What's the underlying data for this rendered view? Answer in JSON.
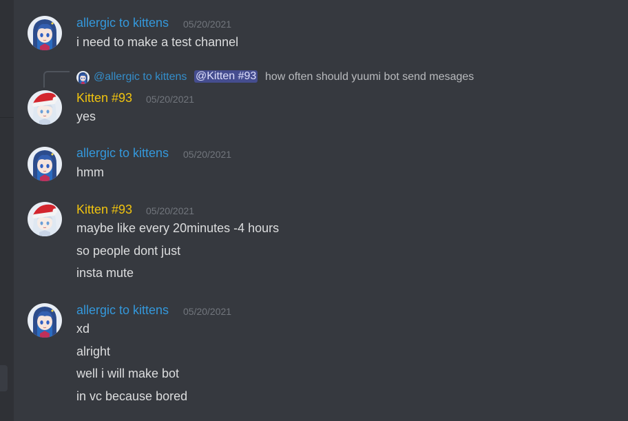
{
  "users": {
    "allergic": {
      "name": "allergic to kittens",
      "color": "#3498db",
      "avatar_icon": "anime-girl-blue-hair-avatar-icon"
    },
    "kitten": {
      "name": "Kitten #93",
      "color": "#f1c40f",
      "avatar_icon": "anime-girl-santa-hat-avatar-icon"
    }
  },
  "messages": [
    {
      "author": "allergic to kittens",
      "timestamp": "05/20/2021",
      "lines": [
        "i need to make a test channel"
      ]
    },
    {
      "reply": {
        "author": "@allergic to kittens",
        "mention": "@Kitten #93",
        "text": "how often should yuumi bot send mesages"
      },
      "author": "Kitten #93",
      "timestamp": "05/20/2021",
      "lines": [
        "yes"
      ]
    },
    {
      "author": "allergic to kittens",
      "timestamp": "05/20/2021",
      "lines": [
        "hmm"
      ]
    },
    {
      "author": "Kitten #93",
      "timestamp": "05/20/2021",
      "lines": [
        "maybe like every 20minutes -4 hours",
        "so people dont just",
        "insta mute"
      ]
    },
    {
      "author": "allergic to kittens",
      "timestamp": "05/20/2021",
      "lines": [
        "xd",
        "alright",
        "well i will make bot",
        "in vc because bored"
      ]
    }
  ]
}
